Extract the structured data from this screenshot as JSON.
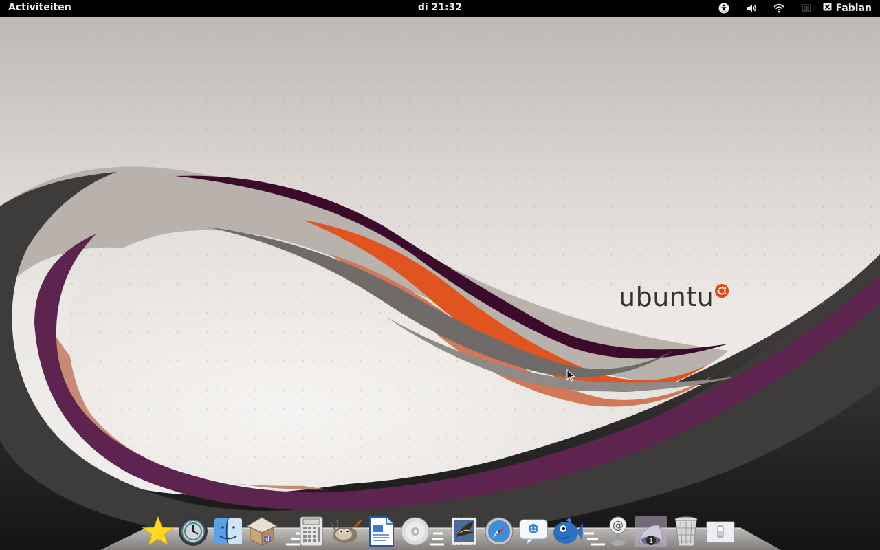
{
  "topbar": {
    "activities_label": "Activiteiten",
    "clock": "di 21:32",
    "user_name": "Fabian",
    "tray_icons": [
      "accessibility-icon",
      "volume-icon",
      "wifi-icon",
      "display-icon",
      "user-icon"
    ]
  },
  "wallpaper": {
    "logo_text": "ubuntu",
    "colors": {
      "background": "#e6e2de",
      "aubergine": "#4a0f33",
      "purple": "#5d2450",
      "orange": "#e0551f",
      "salmon": "#d07857",
      "gray_band": "#7a7674",
      "dark_band": "#3a3838"
    }
  },
  "dock": {
    "items": [
      {
        "name": "favorites-star-icon"
      },
      {
        "name": "time-machine-icon"
      },
      {
        "name": "finder-icon"
      },
      {
        "name": "archive-manager-icon"
      },
      {
        "name": "calculator-icon"
      },
      {
        "name": "gimp-icon"
      },
      {
        "name": "text-document-icon"
      },
      {
        "name": "disc-icon"
      },
      {
        "name": "mail-stamp-icon"
      },
      {
        "name": "safari-compass-icon"
      },
      {
        "name": "chat-messages-icon"
      },
      {
        "name": "fish-icon"
      },
      {
        "name": "email-at-icon"
      },
      {
        "name": "badge-app-icon",
        "badge": "1"
      },
      {
        "name": "trash-icon"
      },
      {
        "name": "light-switch-icon"
      }
    ]
  }
}
